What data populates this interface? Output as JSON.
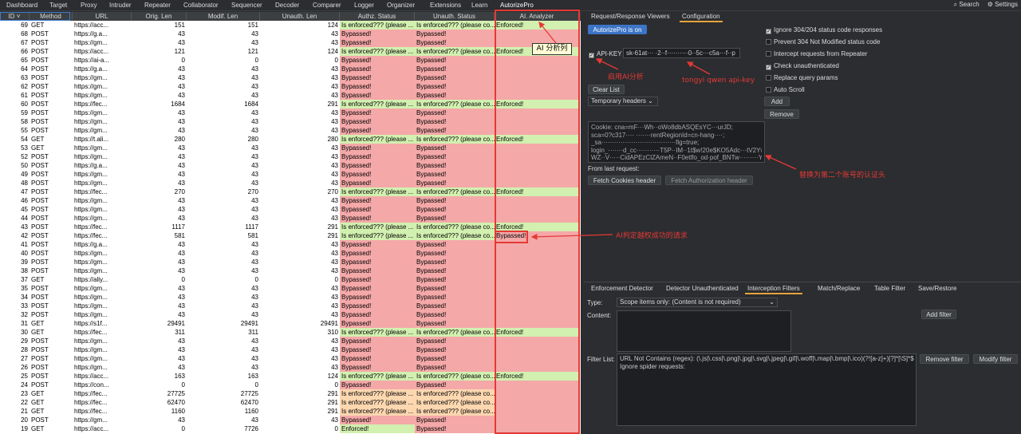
{
  "menu": [
    "Dashboard",
    "Target",
    "Proxy",
    "Intruder",
    "Repeater",
    "Collaborator",
    "Sequencer",
    "Decoder",
    "Comparer",
    "Logger",
    "Organizer",
    "Extensions",
    "Learn",
    "AutorizePro"
  ],
  "menu_right": {
    "search": "⌕ Search",
    "settings": "⚙ Settings"
  },
  "table": {
    "columns": [
      "ID ˅",
      "Method",
      "URL",
      "Orig. Len",
      "Modif. Len",
      "Unauth. Len",
      "Authz. Status",
      "Unauth. Status",
      "AI. Analyzer"
    ],
    "rows": [
      [
        "69",
        "GET",
        "https://acc...",
        "151",
        "151",
        "124",
        "Is enforced??? (please ...",
        "Is enforced??? (please co...",
        "Enforced!"
      ],
      [
        "68",
        "POST",
        "https://g.a...",
        "43",
        "43",
        "43",
        "Bypassed!",
        "Bypassed!",
        ""
      ],
      [
        "67",
        "POST",
        "https://gm...",
        "43",
        "43",
        "43",
        "Bypassed!",
        "Bypassed!",
        ""
      ],
      [
        "66",
        "POST",
        "https://acc...",
        "121",
        "121",
        "124",
        "Is enforced??? (please ...",
        "Is enforced??? (please co...",
        "Enforced!"
      ],
      [
        "65",
        "POST",
        "https://ai-a...",
        "0",
        "0",
        "0",
        "Bypassed!",
        "Bypassed!",
        ""
      ],
      [
        "64",
        "POST",
        "https://g.a...",
        "43",
        "43",
        "43",
        "Bypassed!",
        "Bypassed!",
        ""
      ],
      [
        "63",
        "POST",
        "https://gm...",
        "43",
        "43",
        "43",
        "Bypassed!",
        "Bypassed!",
        ""
      ],
      [
        "62",
        "POST",
        "https://gm...",
        "43",
        "43",
        "43",
        "Bypassed!",
        "Bypassed!",
        ""
      ],
      [
        "61",
        "POST",
        "https://gm...",
        "43",
        "43",
        "43",
        "Bypassed!",
        "Bypassed!",
        ""
      ],
      [
        "60",
        "POST",
        "https://fec...",
        "1684",
        "1684",
        "291",
        "Is enforced??? (please ...",
        "Is enforced??? (please co...",
        "Enforced!"
      ],
      [
        "59",
        "POST",
        "https://gm...",
        "43",
        "43",
        "43",
        "Bypassed!",
        "Bypassed!",
        ""
      ],
      [
        "58",
        "POST",
        "https://gm...",
        "43",
        "43",
        "43",
        "Bypassed!",
        "Bypassed!",
        ""
      ],
      [
        "55",
        "POST",
        "https://gm...",
        "43",
        "43",
        "43",
        "Bypassed!",
        "Bypassed!",
        ""
      ],
      [
        "54",
        "GET",
        "https://t.ali...",
        "280",
        "280",
        "280",
        "Is enforced??? (please ...",
        "Is enforced??? (please co...",
        "Enforced!"
      ],
      [
        "53",
        "GET",
        "https://gm...",
        "43",
        "43",
        "43",
        "Bypassed!",
        "Bypassed!",
        ""
      ],
      [
        "52",
        "POST",
        "https://gm...",
        "43",
        "43",
        "43",
        "Bypassed!",
        "Bypassed!",
        ""
      ],
      [
        "50",
        "POST",
        "https://g.a...",
        "43",
        "43",
        "43",
        "Bypassed!",
        "Bypassed!",
        ""
      ],
      [
        "49",
        "POST",
        "https://gm...",
        "43",
        "43",
        "43",
        "Bypassed!",
        "Bypassed!",
        ""
      ],
      [
        "48",
        "POST",
        "https://gm...",
        "43",
        "43",
        "43",
        "Bypassed!",
        "Bypassed!",
        ""
      ],
      [
        "47",
        "POST",
        "https://fec...",
        "270",
        "270",
        "270",
        "Is enforced??? (please ...",
        "Is enforced??? (please co...",
        "Enforced!"
      ],
      [
        "46",
        "POST",
        "https://gm...",
        "43",
        "43",
        "43",
        "Bypassed!",
        "Bypassed!",
        ""
      ],
      [
        "45",
        "POST",
        "https://gm...",
        "43",
        "43",
        "43",
        "Bypassed!",
        "Bypassed!",
        ""
      ],
      [
        "44",
        "POST",
        "https://gm...",
        "43",
        "43",
        "43",
        "Bypassed!",
        "Bypassed!",
        ""
      ],
      [
        "43",
        "POST",
        "https://fec...",
        "1117",
        "1117",
        "291",
        "Is enforced??? (please ...",
        "Is enforced??? (please co...",
        "Enforced!"
      ],
      [
        "42",
        "POST",
        "https://fec...",
        "581",
        "581",
        "291",
        "Is enforced??? (please ...",
        "Is enforced??? (please co...",
        "Bypassed!"
      ],
      [
        "41",
        "POST",
        "https://g.a...",
        "43",
        "43",
        "43",
        "Bypassed!",
        "Bypassed!",
        ""
      ],
      [
        "40",
        "POST",
        "https://gm...",
        "43",
        "43",
        "43",
        "Bypassed!",
        "Bypassed!",
        ""
      ],
      [
        "39",
        "POST",
        "https://gm...",
        "43",
        "43",
        "43",
        "Bypassed!",
        "Bypassed!",
        ""
      ],
      [
        "38",
        "POST",
        "https://gm...",
        "43",
        "43",
        "43",
        "Bypassed!",
        "Bypassed!",
        ""
      ],
      [
        "37",
        "GET",
        "https://aliy...",
        "0",
        "0",
        "0",
        "Bypassed!",
        "Bypassed!",
        ""
      ],
      [
        "35",
        "POST",
        "https://gm...",
        "43",
        "43",
        "43",
        "Bypassed!",
        "Bypassed!",
        ""
      ],
      [
        "34",
        "POST",
        "https://gm...",
        "43",
        "43",
        "43",
        "Bypassed!",
        "Bypassed!",
        ""
      ],
      [
        "33",
        "POST",
        "https://gm...",
        "43",
        "43",
        "43",
        "Bypassed!",
        "Bypassed!",
        ""
      ],
      [
        "32",
        "POST",
        "https://gm...",
        "43",
        "43",
        "43",
        "Bypassed!",
        "Bypassed!",
        ""
      ],
      [
        "31",
        "GET",
        "https://s1f...",
        "29491",
        "29491",
        "29491",
        "Bypassed!",
        "Bypassed!",
        ""
      ],
      [
        "30",
        "GET",
        "https://fec...",
        "311",
        "311",
        "310",
        "Is enforced??? (please ...",
        "Is enforced??? (please co...",
        "Enforced!"
      ],
      [
        "29",
        "POST",
        "https://gm...",
        "43",
        "43",
        "43",
        "Bypassed!",
        "Bypassed!",
        ""
      ],
      [
        "28",
        "POST",
        "https://gm...",
        "43",
        "43",
        "43",
        "Bypassed!",
        "Bypassed!",
        ""
      ],
      [
        "27",
        "POST",
        "https://gm...",
        "43",
        "43",
        "43",
        "Bypassed!",
        "Bypassed!",
        ""
      ],
      [
        "26",
        "POST",
        "https://gm...",
        "43",
        "43",
        "43",
        "Bypassed!",
        "Bypassed!",
        ""
      ],
      [
        "25",
        "POST",
        "https://acc...",
        "163",
        "163",
        "124",
        "Is enforced??? (please ...",
        "Is enforced??? (please co...",
        "Enforced!"
      ],
      [
        "24",
        "POST",
        "https://con...",
        "0",
        "0",
        "0",
        "Bypassed!",
        "Bypassed!",
        ""
      ],
      [
        "23",
        "GET",
        "https://fec...",
        "27725",
        "27725",
        "291",
        "Is enforced??? (please ...",
        "Is enforced??? (please co...",
        ""
      ],
      [
        "22",
        "GET",
        "https://fec...",
        "62470",
        "62470",
        "291",
        "Is enforced??? (please ...",
        "Is enforced??? (please co...",
        ""
      ],
      [
        "21",
        "GET",
        "https://fec...",
        "1160",
        "1160",
        "291",
        "Is enforced??? (please ...",
        "Is enforced??? (please co...",
        ""
      ],
      [
        "20",
        "POST",
        "https://gm...",
        "43",
        "43",
        "43",
        "Bypassed!",
        "Bypassed!",
        ""
      ],
      [
        "19",
        "GET",
        "https://acc...",
        "0",
        "7726",
        "0",
        "Enforced!",
        "Bypassed!",
        ""
      ]
    ]
  },
  "annotations": {
    "ai_column": "AI 分析列",
    "enable_ai": "启用AI分析",
    "api_key_note": "tongyi qwen api-key",
    "replace_header": "替换为第二个账号的认证头",
    "ai_detect": "AI判定越权成功的请求"
  },
  "right_panel": {
    "tabs_top": [
      "Request/Response Viewers",
      "Configuration"
    ],
    "toggle_button": "AutorizePro is on",
    "api_key_label": "API-KEY",
    "api_key_value": "sk-61at··· ·2··f··········0··5c···c5a···f··p",
    "clear_list": "Clear List",
    "header_mode": "Temporary headers",
    "checkboxes": [
      {
        "label": "Ignore 304/204 status code responses",
        "checked": true
      },
      {
        "label": "Prevent 304 Not Modified status code",
        "checked": false
      },
      {
        "label": "Intercept requests from Repeater",
        "checked": false
      },
      {
        "label": "Check unauthenticated",
        "checked": true
      },
      {
        "label": "Replace query params",
        "checked": false
      },
      {
        "label": "Auto Scroll",
        "checked": false
      }
    ],
    "add": "Add",
    "remove": "Remove",
    "header_lines": [
      "Cookie: cna=mF···Wh··oWo8dbASQEsYC···urJD;",
      "sca=0?c317···· ·······rentRegionId=cn-hang····;",
      "_sa···································fig=true;",
      "login_·······d_cc···········T5P··IM··1t$w!20e$KO5Adc···tV2Yw",
      "WZ··V·····CidAPEzClZAmeN··F0etlfo_od·pof_BNTw·········YOSN"
    ],
    "from_last": "From last request:",
    "fetch_cookies": "Fetch Cookies header",
    "fetch_auth": "Fetch Authorization header",
    "tabs_bottom": [
      "Enforcement Detector",
      "Detector Unauthenticated",
      "Interception Filters",
      "Match/Replace",
      "Table Filter",
      "Save/Restore"
    ],
    "type_label": "Type:",
    "type_value": "Scope items only: (Content is not required)",
    "content_label": "Content:",
    "add_filter": "Add filter",
    "filter_list_label": "Filter List:",
    "filter_items": [
      "URL Not Contains (regex): (\\.js|\\.css|\\.png|\\.jpg|\\.svg|\\.jpeg|\\.gif|\\.woff|\\.map|\\.bmp|\\.ico)(?![a-z]+)[?]*[\\S]*$",
      "Ignore spider requests:"
    ],
    "remove_filter": "Remove filter",
    "modify_filter": "Modify filter"
  },
  "colors": {
    "red_cell": "#f4a8a8",
    "green_cell": "#d2f0b0",
    "orange_cell": "#fcd7b0",
    "annotation": "#e53935",
    "accent": "#e8a33c",
    "blue_button": "#3c74c7"
  }
}
